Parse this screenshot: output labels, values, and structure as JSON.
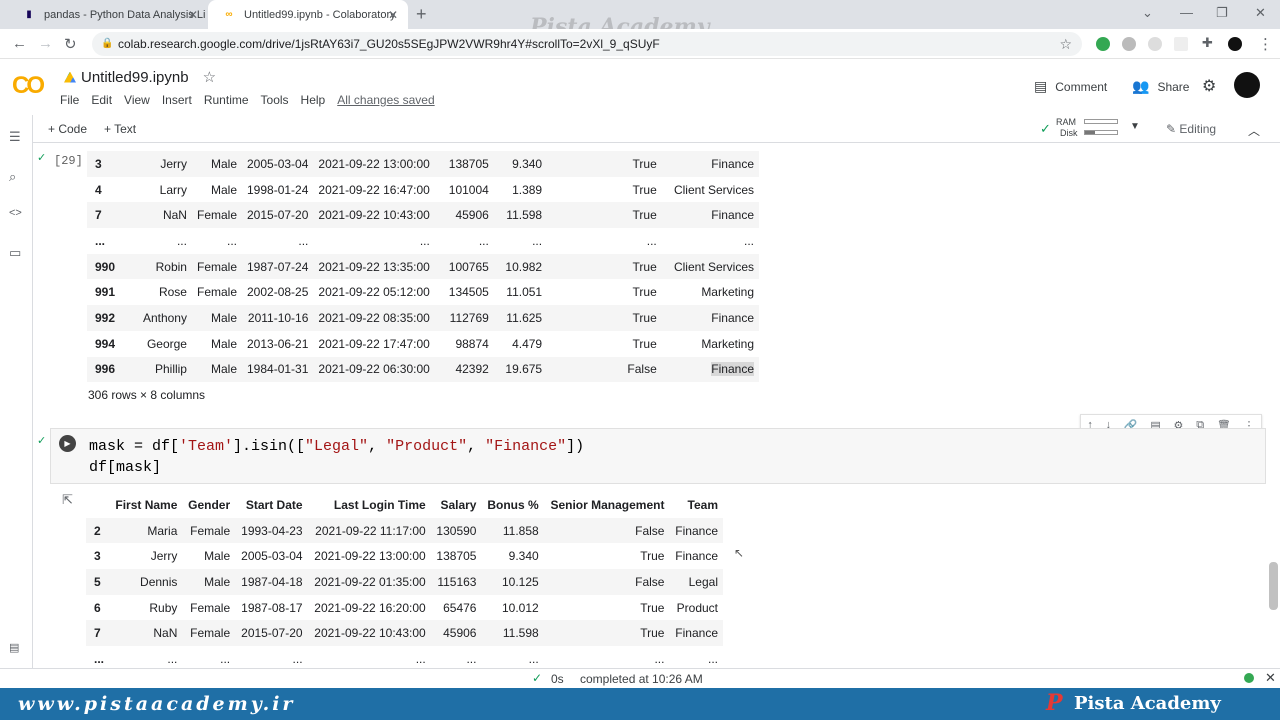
{
  "browser": {
    "tabs": [
      {
        "title": "pandas - Python Data Analysis Li",
        "icon": "pandas-icon"
      },
      {
        "title": "Untitled99.ipynb - Colaboratory",
        "icon": "colab-icon"
      }
    ],
    "watermark": "Pista Academy",
    "url": "colab.research.google.com/drive/1jsRtAY63i7_GU20s5SEgJPW2VWR9hr4Y#scrollTo=2vXl_9_qSUyF"
  },
  "colab": {
    "logo": "CO",
    "title": "Untitled99.ipynb",
    "menu": [
      "File",
      "Edit",
      "View",
      "Insert",
      "Runtime",
      "Tools",
      "Help"
    ],
    "saved": "All changes saved",
    "comment": "Comment",
    "share": "Share",
    "add_code": "Code",
    "add_text": "Text",
    "ram": "RAM",
    "disk": "Disk",
    "editing": "Editing"
  },
  "cell1": {
    "exec_count": "[29]",
    "rows": [
      [
        "3",
        "Jerry",
        "Male",
        "2005-03-04",
        "2021-09-22 13:00:00",
        "138705",
        "9.340",
        "True",
        "Finance"
      ],
      [
        "4",
        "Larry",
        "Male",
        "1998-01-24",
        "2021-09-22 16:47:00",
        "101004",
        "1.389",
        "True",
        "Client Services"
      ],
      [
        "7",
        "NaN",
        "Female",
        "2015-07-20",
        "2021-09-22 10:43:00",
        "45906",
        "11.598",
        "True",
        "Finance"
      ],
      [
        "...",
        "...",
        "...",
        "...",
        "...",
        "...",
        "...",
        "...",
        "..."
      ],
      [
        "990",
        "Robin",
        "Female",
        "1987-07-24",
        "2021-09-22 13:35:00",
        "100765",
        "10.982",
        "True",
        "Client Services"
      ],
      [
        "991",
        "Rose",
        "Female",
        "2002-08-25",
        "2021-09-22 05:12:00",
        "134505",
        "11.051",
        "True",
        "Marketing"
      ],
      [
        "992",
        "Anthony",
        "Male",
        "2011-10-16",
        "2021-09-22 08:35:00",
        "112769",
        "11.625",
        "True",
        "Finance"
      ],
      [
        "994",
        "George",
        "Male",
        "2013-06-21",
        "2021-09-22 17:47:00",
        "98874",
        "4.479",
        "True",
        "Marketing"
      ],
      [
        "996",
        "Phillip",
        "Male",
        "1984-01-31",
        "2021-09-22 06:30:00",
        "42392",
        "19.675",
        "False",
        "Finance"
      ]
    ],
    "summary": "306 rows × 8 columns"
  },
  "cell2": {
    "code_line1_a": "mask = df[",
    "code_line1_s1": "'Team'",
    "code_line1_b": "].isin([",
    "code_line1_s2": "\"Legal\"",
    "code_line1_c": ", ",
    "code_line1_s3": "\"Product\"",
    "code_line1_d": ", ",
    "code_line1_s4": "\"Finance\"",
    "code_line1_e": "])",
    "code_line2": "df[mask]",
    "headers": [
      "",
      "First Name",
      "Gender",
      "Start Date",
      "Last Login Time",
      "Salary",
      "Bonus %",
      "Senior Management",
      "Team"
    ],
    "rows": [
      [
        "2",
        "Maria",
        "Female",
        "1993-04-23",
        "2021-09-22 11:17:00",
        "130590",
        "11.858",
        "False",
        "Finance"
      ],
      [
        "3",
        "Jerry",
        "Male",
        "2005-03-04",
        "2021-09-22 13:00:00",
        "138705",
        "9.340",
        "True",
        "Finance"
      ],
      [
        "5",
        "Dennis",
        "Male",
        "1987-04-18",
        "2021-09-22 01:35:00",
        "115163",
        "10.125",
        "False",
        "Legal"
      ],
      [
        "6",
        "Ruby",
        "Female",
        "1987-08-17",
        "2021-09-22 16:20:00",
        "65476",
        "10.012",
        "True",
        "Product"
      ],
      [
        "7",
        "NaN",
        "Female",
        "2015-07-20",
        "2021-09-22 10:43:00",
        "45906",
        "11.598",
        "True",
        "Finance"
      ],
      [
        "...",
        "...",
        "...",
        "...",
        "...",
        "...",
        "...",
        "...",
        "..."
      ]
    ]
  },
  "status": {
    "duration": "0s",
    "message": "completed at 10:26 AM"
  },
  "banner": {
    "site": "www.pistaacademy.ir",
    "p": "P",
    "brand": "Pista Academy"
  }
}
